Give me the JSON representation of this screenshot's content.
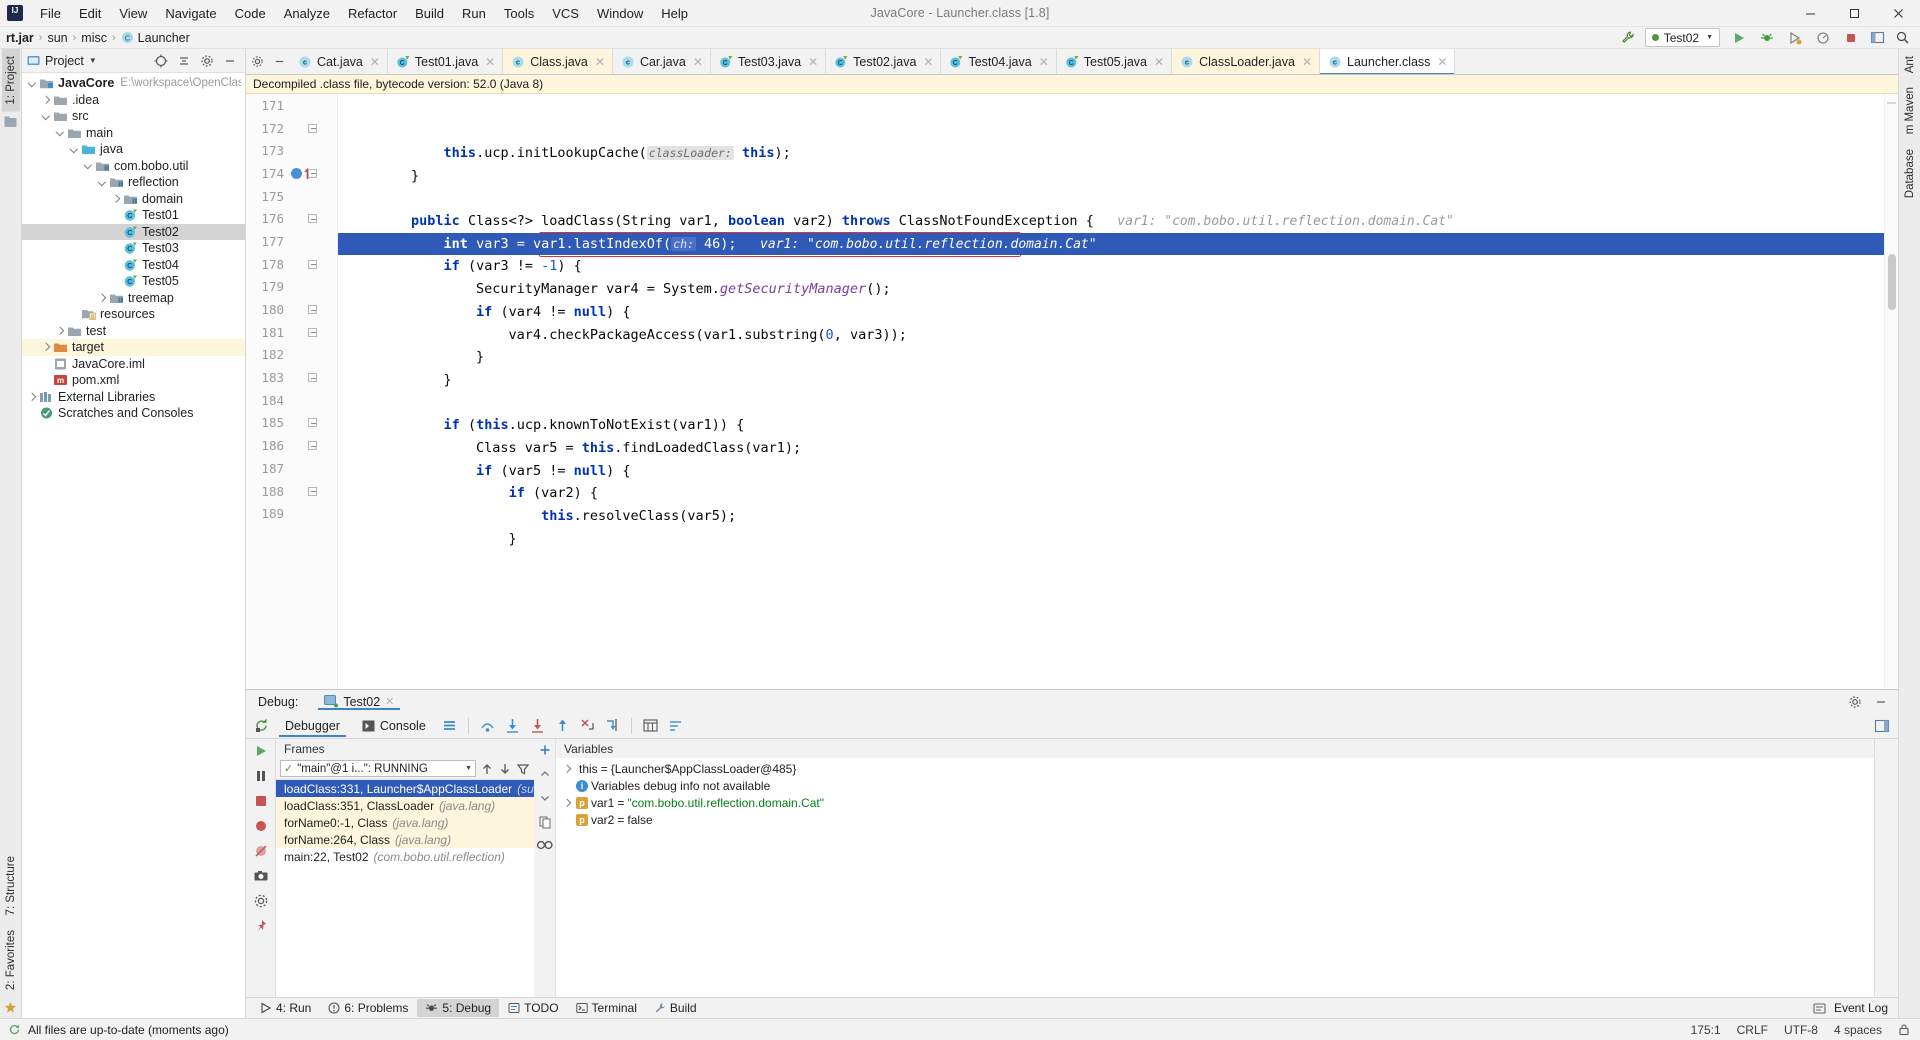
{
  "window": {
    "title": "JavaCore - Launcher.class [1.8]",
    "logo": "intellij-idea-logo",
    "minimize": "–",
    "maximize": "☐",
    "close": "✕"
  },
  "menu": {
    "items": [
      "File",
      "Edit",
      "View",
      "Navigate",
      "Code",
      "Analyze",
      "Refactor",
      "Build",
      "Run",
      "Tools",
      "VCS",
      "Window",
      "Help"
    ]
  },
  "navbar": {
    "crumbs": [
      {
        "label": "rt.jar",
        "bold": true,
        "icon": "jar-icon"
      },
      {
        "label": "sun",
        "bold": false,
        "icon": ""
      },
      {
        "label": "misc",
        "bold": false,
        "icon": ""
      },
      {
        "label": "Launcher",
        "bold": false,
        "icon": "class-icon"
      }
    ],
    "separator": "›"
  },
  "run_widget": {
    "config_name": "Test02",
    "run_icon": "run-icon",
    "debug_icon": "debug-icon",
    "coverage_icon": "coverage-icon",
    "profile_icon": "profile-icon",
    "stop_icon": "stop-icon",
    "layout_icon": "layout-icon",
    "search_icon": "search-icon",
    "wrench_icon": "wrench-icon"
  },
  "left_stripe": {
    "top": [
      {
        "label": "1: Project",
        "selected": true
      }
    ],
    "bottom": [
      {
        "label": "7: Structure",
        "selected": false
      },
      {
        "label": "2: Favorites",
        "selected": false
      }
    ]
  },
  "right_stripe": {
    "items": [
      "Ant",
      "m Maven",
      "Database"
    ]
  },
  "project_panel": {
    "title": "Project",
    "caret": "▼",
    "actions": [
      "target-icon",
      "collapse-all-icon",
      "settings-icon",
      "hide-icon"
    ],
    "tree": [
      {
        "indent": 0,
        "arrow": "down",
        "icon": "module-icon",
        "label": "JavaCore",
        "bold": true,
        "sub": "E:\\workspace\\OpenClassWork",
        "state": "normal"
      },
      {
        "indent": 1,
        "arrow": "right",
        "icon": "folder-icon",
        "label": ".idea",
        "bold": false,
        "sub": "",
        "state": "normal"
      },
      {
        "indent": 1,
        "arrow": "down",
        "icon": "folder-icon",
        "label": "src",
        "bold": false,
        "sub": "",
        "state": "normal"
      },
      {
        "indent": 2,
        "arrow": "down",
        "icon": "folder-icon",
        "label": "main",
        "bold": false,
        "sub": "",
        "state": "normal"
      },
      {
        "indent": 3,
        "arrow": "down",
        "icon": "source-folder-icon",
        "label": "java",
        "bold": false,
        "sub": "",
        "state": "normal"
      },
      {
        "indent": 4,
        "arrow": "down",
        "icon": "package-icon",
        "label": "com.bobo.util",
        "bold": false,
        "sub": "",
        "state": "normal"
      },
      {
        "indent": 5,
        "arrow": "down",
        "icon": "package-icon",
        "label": "reflection",
        "bold": false,
        "sub": "",
        "state": "normal"
      },
      {
        "indent": 6,
        "arrow": "right",
        "icon": "package-icon",
        "label": "domain",
        "bold": false,
        "sub": "",
        "state": "normal"
      },
      {
        "indent": 6,
        "arrow": "none",
        "icon": "java-class-icon",
        "label": "Test01",
        "bold": false,
        "sub": "",
        "state": "normal"
      },
      {
        "indent": 6,
        "arrow": "none",
        "icon": "java-class-icon",
        "label": "Test02",
        "bold": false,
        "sub": "",
        "state": "selected"
      },
      {
        "indent": 6,
        "arrow": "none",
        "icon": "java-class-icon",
        "label": "Test03",
        "bold": false,
        "sub": "",
        "state": "normal"
      },
      {
        "indent": 6,
        "arrow": "none",
        "icon": "java-class-icon",
        "label": "Test04",
        "bold": false,
        "sub": "",
        "state": "normal"
      },
      {
        "indent": 6,
        "arrow": "none",
        "icon": "java-class-icon",
        "label": "Test05",
        "bold": false,
        "sub": "",
        "state": "normal"
      },
      {
        "indent": 5,
        "arrow": "right",
        "icon": "package-icon",
        "label": "treemap",
        "bold": false,
        "sub": "",
        "state": "normal"
      },
      {
        "indent": 3,
        "arrow": "none",
        "icon": "resources-folder-icon",
        "label": "resources",
        "bold": false,
        "sub": "",
        "state": "normal"
      },
      {
        "indent": 2,
        "arrow": "right",
        "icon": "folder-icon",
        "label": "test",
        "bold": false,
        "sub": "",
        "state": "normal"
      },
      {
        "indent": 1,
        "arrow": "right",
        "icon": "target-folder-icon",
        "label": "target",
        "bold": false,
        "sub": "",
        "state": "highlighted"
      },
      {
        "indent": 1,
        "arrow": "none",
        "icon": "iml-icon",
        "label": "JavaCore.iml",
        "bold": false,
        "sub": "",
        "state": "normal"
      },
      {
        "indent": 1,
        "arrow": "none",
        "icon": "maven-icon",
        "label": "pom.xml",
        "bold": false,
        "sub": "",
        "state": "normal"
      },
      {
        "indent": 0,
        "arrow": "right",
        "icon": "library-icon",
        "label": "External Libraries",
        "bold": false,
        "sub": "",
        "state": "normal"
      },
      {
        "indent": 0,
        "arrow": "none",
        "icon": "scratches-icon",
        "label": "Scratches and Consoles",
        "bold": false,
        "sub": "",
        "state": "normal"
      }
    ]
  },
  "editor_tabs": {
    "items": [
      {
        "label": "Cat.java",
        "icon": "class-icon",
        "state": "normal"
      },
      {
        "label": "Test01.java",
        "icon": "runnable-class-icon",
        "state": "normal"
      },
      {
        "label": "Class.java",
        "icon": "class-icon",
        "state": "library"
      },
      {
        "label": "Car.java",
        "icon": "class-icon",
        "state": "normal"
      },
      {
        "label": "Test03.java",
        "icon": "runnable-class-icon",
        "state": "normal"
      },
      {
        "label": "Test02.java",
        "icon": "runnable-class-icon",
        "state": "normal"
      },
      {
        "label": "Test04.java",
        "icon": "runnable-class-icon",
        "state": "normal"
      },
      {
        "label": "Test05.java",
        "icon": "runnable-class-icon",
        "state": "normal"
      },
      {
        "label": "ClassLoader.java",
        "icon": "class-icon",
        "state": "library"
      },
      {
        "label": "Launcher.class",
        "icon": "class-icon",
        "state": "current"
      }
    ],
    "close_glyph": "✕",
    "settings_icon": "gear-icon",
    "hide_icon": "minus-icon"
  },
  "notification": {
    "text": "Decompiled .class file, bytecode version: 52.0 (Java 8)"
  },
  "editor": {
    "first_line": 171,
    "highlight_line": 175,
    "breakpoint_line": 174,
    "lines": [
      {
        "n": 171,
        "fold": "none",
        "segments": [
          {
            "t": "            ",
            "c": "plain"
          },
          {
            "t": "this",
            "c": "kw"
          },
          {
            "t": ".",
            "c": "plain"
          },
          {
            "t": "ucp",
            "c": "field"
          },
          {
            "t": ".initLookupCache(",
            "c": "plain"
          },
          {
            "t": "classLoader:",
            "c": "param"
          },
          {
            "t": " ",
            "c": "plain"
          },
          {
            "t": "this",
            "c": "kw"
          },
          {
            "t": ");",
            "c": "plain"
          }
        ]
      },
      {
        "n": 172,
        "fold": "end",
        "segments": [
          {
            "t": "        }",
            "c": "plain"
          }
        ]
      },
      {
        "n": 173,
        "fold": "none",
        "segments": [
          {
            "t": "",
            "c": "plain"
          }
        ]
      },
      {
        "n": 174,
        "fold": "start",
        "segments": [
          {
            "t": "        ",
            "c": "plain"
          },
          {
            "t": "public",
            "c": "kw"
          },
          {
            "t": " Class<?> loadClass(String var1, ",
            "c": "plain"
          },
          {
            "t": "boolean",
            "c": "kw"
          },
          {
            "t": " var2) ",
            "c": "plain"
          },
          {
            "t": "throws",
            "c": "kw"
          },
          {
            "t": " ClassNotFoundException {",
            "c": "plain"
          },
          {
            "t": "   var1: \"com.bobo.util.reflection.domain.Cat\"",
            "c": "hint"
          }
        ]
      },
      {
        "n": 175,
        "fold": "none",
        "highlight": true,
        "segments": [
          {
            "t": "            ",
            "c": "plain"
          },
          {
            "t": "int",
            "c": "kw"
          },
          {
            "t": " var3 = var1.lastIndexOf(",
            "c": "plain"
          },
          {
            "t": "ch:",
            "c": "param"
          },
          {
            "t": " 46);",
            "c": "plain"
          },
          {
            "t": "   var1: \"com.bobo.util.reflection.domain.Cat\"",
            "c": "hint"
          }
        ]
      },
      {
        "n": 176,
        "fold": "start",
        "segments": [
          {
            "t": "            ",
            "c": "plain"
          },
          {
            "t": "if",
            "c": "kw"
          },
          {
            "t": " (var3 != ",
            "c": "plain"
          },
          {
            "t": "-1",
            "c": "num"
          },
          {
            "t": ") {",
            "c": "plain"
          }
        ]
      },
      {
        "n": 177,
        "fold": "none",
        "boxed": true,
        "segments": [
          {
            "t": "                SecurityManager var4 = System.",
            "c": "plain"
          },
          {
            "t": "getSecurityManager",
            "c": "kw2"
          },
          {
            "t": "();",
            "c": "plain"
          }
        ]
      },
      {
        "n": 178,
        "fold": "start",
        "segments": [
          {
            "t": "                ",
            "c": "plain"
          },
          {
            "t": "if",
            "c": "kw"
          },
          {
            "t": " (var4 != ",
            "c": "plain"
          },
          {
            "t": "null",
            "c": "kw"
          },
          {
            "t": ") {",
            "c": "plain"
          }
        ]
      },
      {
        "n": 179,
        "fold": "none",
        "segments": [
          {
            "t": "                    var4.checkPackageAccess(var1.substring(",
            "c": "plain"
          },
          {
            "t": "0",
            "c": "num"
          },
          {
            "t": ", var3));",
            "c": "plain"
          }
        ]
      },
      {
        "n": 180,
        "fold": "end",
        "segments": [
          {
            "t": "                }",
            "c": "plain"
          }
        ]
      },
      {
        "n": 181,
        "fold": "end",
        "segments": [
          {
            "t": "            }",
            "c": "plain"
          }
        ]
      },
      {
        "n": 182,
        "fold": "none",
        "segments": [
          {
            "t": "",
            "c": "plain"
          }
        ]
      },
      {
        "n": 183,
        "fold": "start",
        "segments": [
          {
            "t": "            ",
            "c": "plain"
          },
          {
            "t": "if",
            "c": "kw"
          },
          {
            "t": " (",
            "c": "plain"
          },
          {
            "t": "this",
            "c": "kw"
          },
          {
            "t": ".ucp.knownToNotExist(var1)) {",
            "c": "plain"
          }
        ]
      },
      {
        "n": 184,
        "fold": "none",
        "segments": [
          {
            "t": "                Class var5 = ",
            "c": "plain"
          },
          {
            "t": "this",
            "c": "kw"
          },
          {
            "t": ".findLoadedClass(var1);",
            "c": "plain"
          }
        ]
      },
      {
        "n": 185,
        "fold": "start",
        "segments": [
          {
            "t": "                ",
            "c": "plain"
          },
          {
            "t": "if",
            "c": "kw"
          },
          {
            "t": " (var5 != ",
            "c": "plain"
          },
          {
            "t": "null",
            "c": "kw"
          },
          {
            "t": ") {",
            "c": "plain"
          }
        ]
      },
      {
        "n": 186,
        "fold": "start",
        "segments": [
          {
            "t": "                    ",
            "c": "plain"
          },
          {
            "t": "if",
            "c": "kw"
          },
          {
            "t": " (var2) {",
            "c": "plain"
          }
        ]
      },
      {
        "n": 187,
        "fold": "none",
        "segments": [
          {
            "t": "                        ",
            "c": "plain"
          },
          {
            "t": "this",
            "c": "kw"
          },
          {
            "t": ".resolveClass(var5);",
            "c": "plain"
          }
        ]
      },
      {
        "n": 188,
        "fold": "end",
        "segments": [
          {
            "t": "                    }",
            "c": "plain"
          }
        ]
      },
      {
        "n": 189,
        "fold": "none",
        "segments": [
          {
            "t": "",
            "c": "plain"
          }
        ]
      }
    ]
  },
  "debug": {
    "header_label": "Debug:",
    "session_name": "Test02",
    "session_close": "✕",
    "settings_icon": "gear-icon",
    "hide_icon": "minus-icon",
    "layout_icon": "layout-icon",
    "restore_icon": "restore-layout-icon",
    "tabs": [
      {
        "label": "Debugger",
        "icon": "",
        "selected": true
      },
      {
        "label": "Console",
        "icon": "console-icon",
        "selected": false
      }
    ],
    "toolbar_icons": [
      "rerun-icon",
      "menu-icon",
      "step-over-icon",
      "step-into-icon",
      "force-step-into-icon",
      "step-out-icon",
      "drop-frame-icon",
      "run-to-cursor-icon",
      "evaluate-icon",
      "settings2-icon"
    ],
    "side_icons": [
      "resume-icon",
      "pause-icon",
      "stop-icon",
      "breakpoints-icon",
      "mute-breakpoints-icon",
      "camera-icon",
      "settings-icon",
      "pin-icon"
    ],
    "frames": {
      "title": "Frames",
      "thread": {
        "status_icon": "running-check-icon",
        "label": "\"main\"@1 i...\": RUNNING",
        "caret": "▼",
        "up_icon": "arrow-up-icon",
        "down_icon": "arrow-down-icon",
        "filter_icon": "filter-icon"
      },
      "items": [
        {
          "method": "loadClass:331, Launcher$AppClassLoader",
          "pkg": "(sun.misc)",
          "state": "selected"
        },
        {
          "method": "loadClass:351, ClassLoader",
          "pkg": "(java.lang)",
          "state": "library"
        },
        {
          "method": "forName0:-1, Class",
          "pkg": "(java.lang)",
          "state": "library"
        },
        {
          "method": "forName:264, Class",
          "pkg": "(java.lang)",
          "state": "library"
        },
        {
          "method": "main:22, Test02",
          "pkg": "(com.bobo.util.reflection)",
          "state": "normal"
        }
      ],
      "gutter_icons": [
        "add-icon",
        "arrow-up-icon",
        "arrow-down-icon",
        "copy-icon",
        "infinity-icon"
      ]
    },
    "variables": {
      "title": "Variables",
      "items": [
        {
          "arrow": "right",
          "badge": "",
          "badge_type": "none",
          "name": "this",
          "eq": " = ",
          "value": "{Launcher$AppClassLoader@485}",
          "value_type": "obj"
        },
        {
          "arrow": "none",
          "badge": "i",
          "badge_type": "info",
          "name": "",
          "eq": "",
          "value": "Variables debug info not available",
          "value_type": "plain"
        },
        {
          "arrow": "right",
          "badge": "p",
          "badge_type": "param",
          "name": "var1",
          "eq": " = ",
          "value": "\"com.bobo.util.reflection.domain.Cat\"",
          "value_type": "str"
        },
        {
          "arrow": "none",
          "badge": "p",
          "badge_type": "param",
          "name": "var2",
          "eq": " = ",
          "value": "false",
          "value_type": "plain"
        }
      ]
    }
  },
  "bottom_bar": {
    "items": [
      {
        "label": "4: Run",
        "icon": "run-icon",
        "selected": false
      },
      {
        "label": "6: Problems",
        "icon": "problems-icon",
        "selected": false
      },
      {
        "label": "5: Debug",
        "icon": "debug-icon",
        "selected": true
      },
      {
        "label": "TODO",
        "icon": "todo-icon",
        "selected": false
      },
      {
        "label": "Terminal",
        "icon": "terminal-icon",
        "selected": false
      },
      {
        "label": "Build",
        "icon": "build-icon",
        "selected": false
      }
    ],
    "event_log": "Event Log",
    "event_log_icon": "event-log-icon"
  },
  "status_bar": {
    "message": "All files are up-to-date (moments ago)",
    "message_icon": "sync-icon",
    "caret_position": "175:1",
    "line_separator": "CRLF",
    "encoding": "UTF-8",
    "indent": "4 spaces",
    "lock_icon": "lock-icon"
  },
  "colors": {
    "accent": "#4083c9",
    "selection": "#2f5ab8",
    "highlight_box": "#e03030",
    "notification_bg": "#fdf6dd",
    "keyword": "#0033b3",
    "string": "#067d17",
    "number": "#1750eb",
    "hint": "#9a9a9a",
    "tree_selected": "#d4d4d4"
  }
}
